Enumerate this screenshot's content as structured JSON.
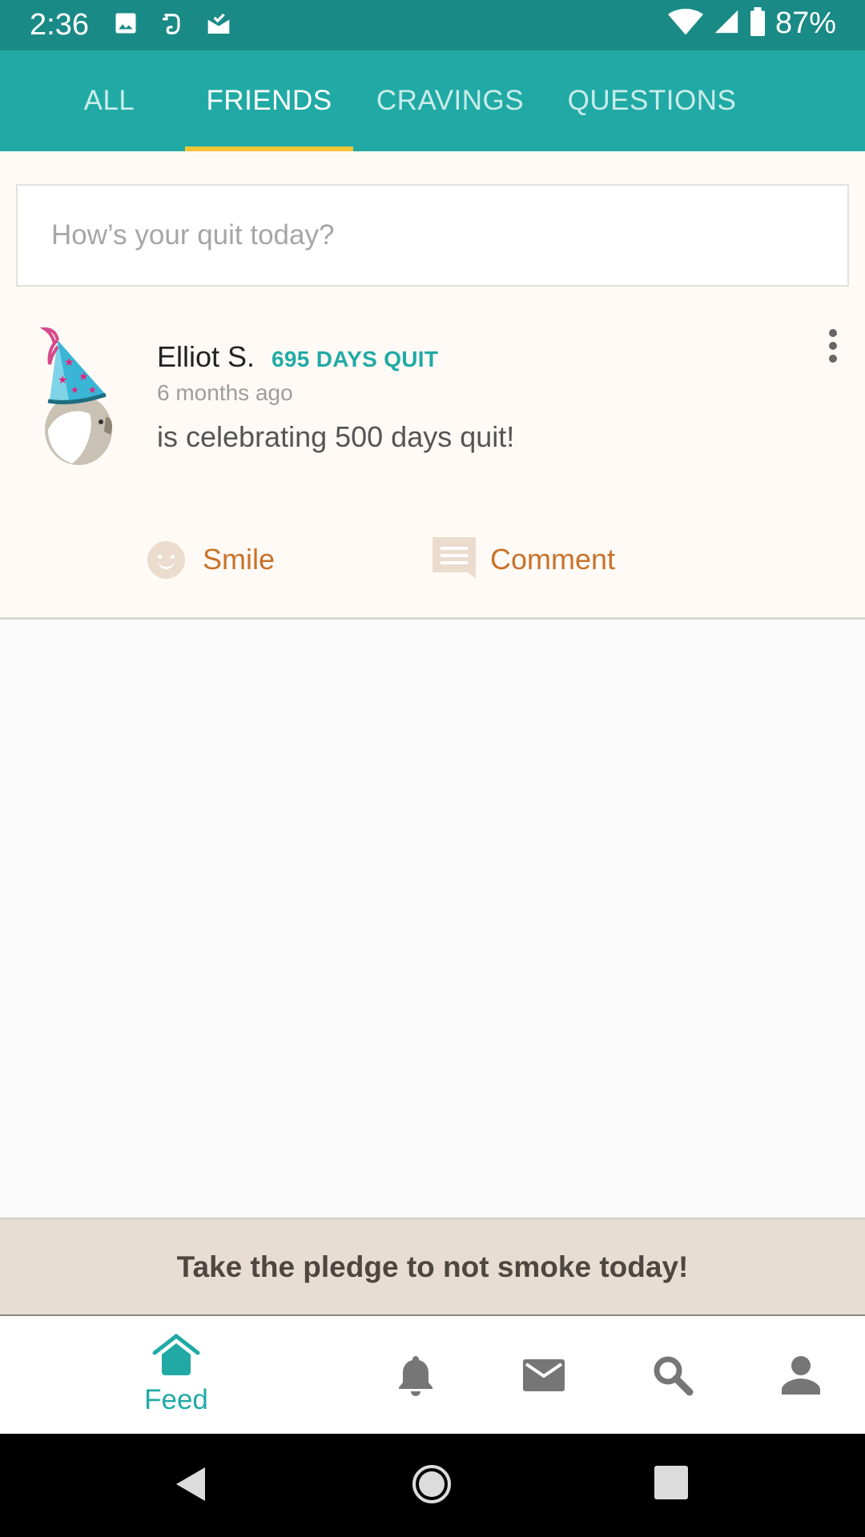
{
  "status_bar": {
    "time": "2:36",
    "battery": "87%",
    "icons": [
      "image-icon",
      "evernote-icon",
      "mail-check-icon",
      "wifi-icon",
      "signal-icon",
      "battery-icon"
    ]
  },
  "tabs": [
    {
      "label": "ALL",
      "active": false
    },
    {
      "label": "FRIENDS",
      "active": true
    },
    {
      "label": "CRAVINGS",
      "active": false
    },
    {
      "label": "QUESTIONS",
      "active": false
    }
  ],
  "compose": {
    "placeholder": "How’s your quit today?",
    "value": ""
  },
  "post": {
    "author": "Elliot S.",
    "badge": "695 DAYS QUIT",
    "time": "6 months ago",
    "text": "is celebrating 500 days quit!",
    "actions": {
      "smile": "Smile",
      "comment": "Comment"
    }
  },
  "pledge": {
    "text": "Take the pledge to not smoke today!"
  },
  "bottom_nav": {
    "feed_label": "Feed",
    "icons": [
      "home-icon",
      "bell-icon",
      "mail-icon",
      "search-icon",
      "person-icon"
    ]
  },
  "colors": {
    "status_bar": "#1a8a86",
    "tab_bar": "#21aaa5",
    "tab_underline": "#f3c634",
    "accent_orange": "#c8722a",
    "pledge_bg": "#e8ddd2"
  }
}
